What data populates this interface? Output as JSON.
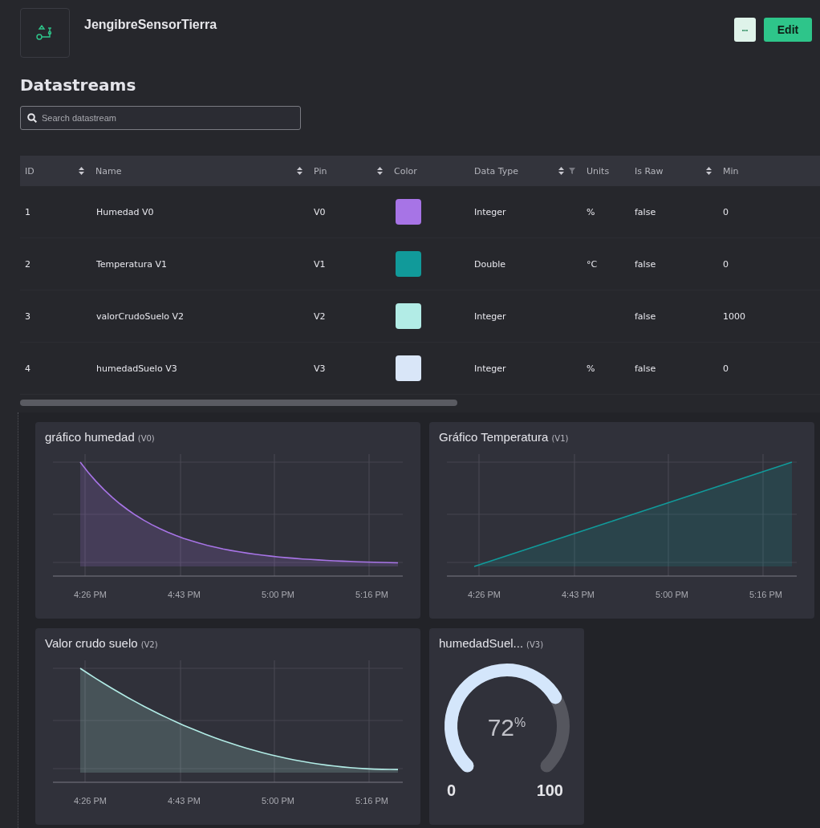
{
  "device": {
    "name": "JengibreSensorTierra"
  },
  "header_buttons": {
    "more": "•••",
    "edit": "Edit"
  },
  "section_title": "Datastreams",
  "search": {
    "placeholder": "Search datastream"
  },
  "table": {
    "columns": [
      {
        "label": "ID",
        "sortable": true,
        "filter": false
      },
      {
        "label": "Name",
        "sortable": true,
        "filter": false
      },
      {
        "label": "Pin",
        "sortable": true,
        "filter": false
      },
      {
        "label": "Color",
        "sortable": false,
        "filter": false
      },
      {
        "label": "Data Type",
        "sortable": true,
        "filter": true
      },
      {
        "label": "Units",
        "sortable": false,
        "filter": false
      },
      {
        "label": "Is Raw",
        "sortable": true,
        "filter": false
      },
      {
        "label": "Min",
        "sortable": false,
        "filter": false
      }
    ],
    "rows": [
      {
        "id": "1",
        "name": "Humedad V0",
        "pin": "V0",
        "color": "#a774e6",
        "data_type": "Integer",
        "units": "%",
        "is_raw": "false",
        "min": "0"
      },
      {
        "id": "2",
        "name": "Temperatura V1",
        "pin": "V1",
        "color": "#119a9a",
        "data_type": "Double",
        "units": "°C",
        "is_raw": "false",
        "min": "0"
      },
      {
        "id": "3",
        "name": "valorCrudoSuelo V2",
        "pin": "V2",
        "color": "#b2ece6",
        "data_type": "Integer",
        "units": "",
        "is_raw": "false",
        "min": "1000"
      },
      {
        "id": "4",
        "name": "humedadSuelo V3",
        "pin": "V3",
        "color": "#d9e6f8",
        "data_type": "Integer",
        "units": "%",
        "is_raw": "false",
        "min": "0"
      }
    ]
  },
  "widgets": [
    {
      "kind": "chart",
      "title": "gráfico humedad",
      "pin": "(V0)",
      "x_labels": [
        "4:26 PM",
        "4:43 PM",
        "5:00 PM",
        "5:16 PM"
      ]
    },
    {
      "kind": "chart",
      "title": "Gráfico Temperatura",
      "pin": "(V1)",
      "x_labels": [
        "4:26 PM",
        "4:43 PM",
        "5:00 PM",
        "5:16 PM"
      ]
    },
    {
      "kind": "chart",
      "title": "Valor crudo suelo",
      "pin": "(V2)",
      "x_labels": [
        "4:26 PM",
        "4:43 PM",
        "5:00 PM",
        "5:16 PM"
      ]
    },
    {
      "kind": "gauge",
      "title": "humedadSuel...",
      "pin": "(V3)",
      "value": "72",
      "unit": "%",
      "min": "0",
      "max": "100"
    }
  ]
}
